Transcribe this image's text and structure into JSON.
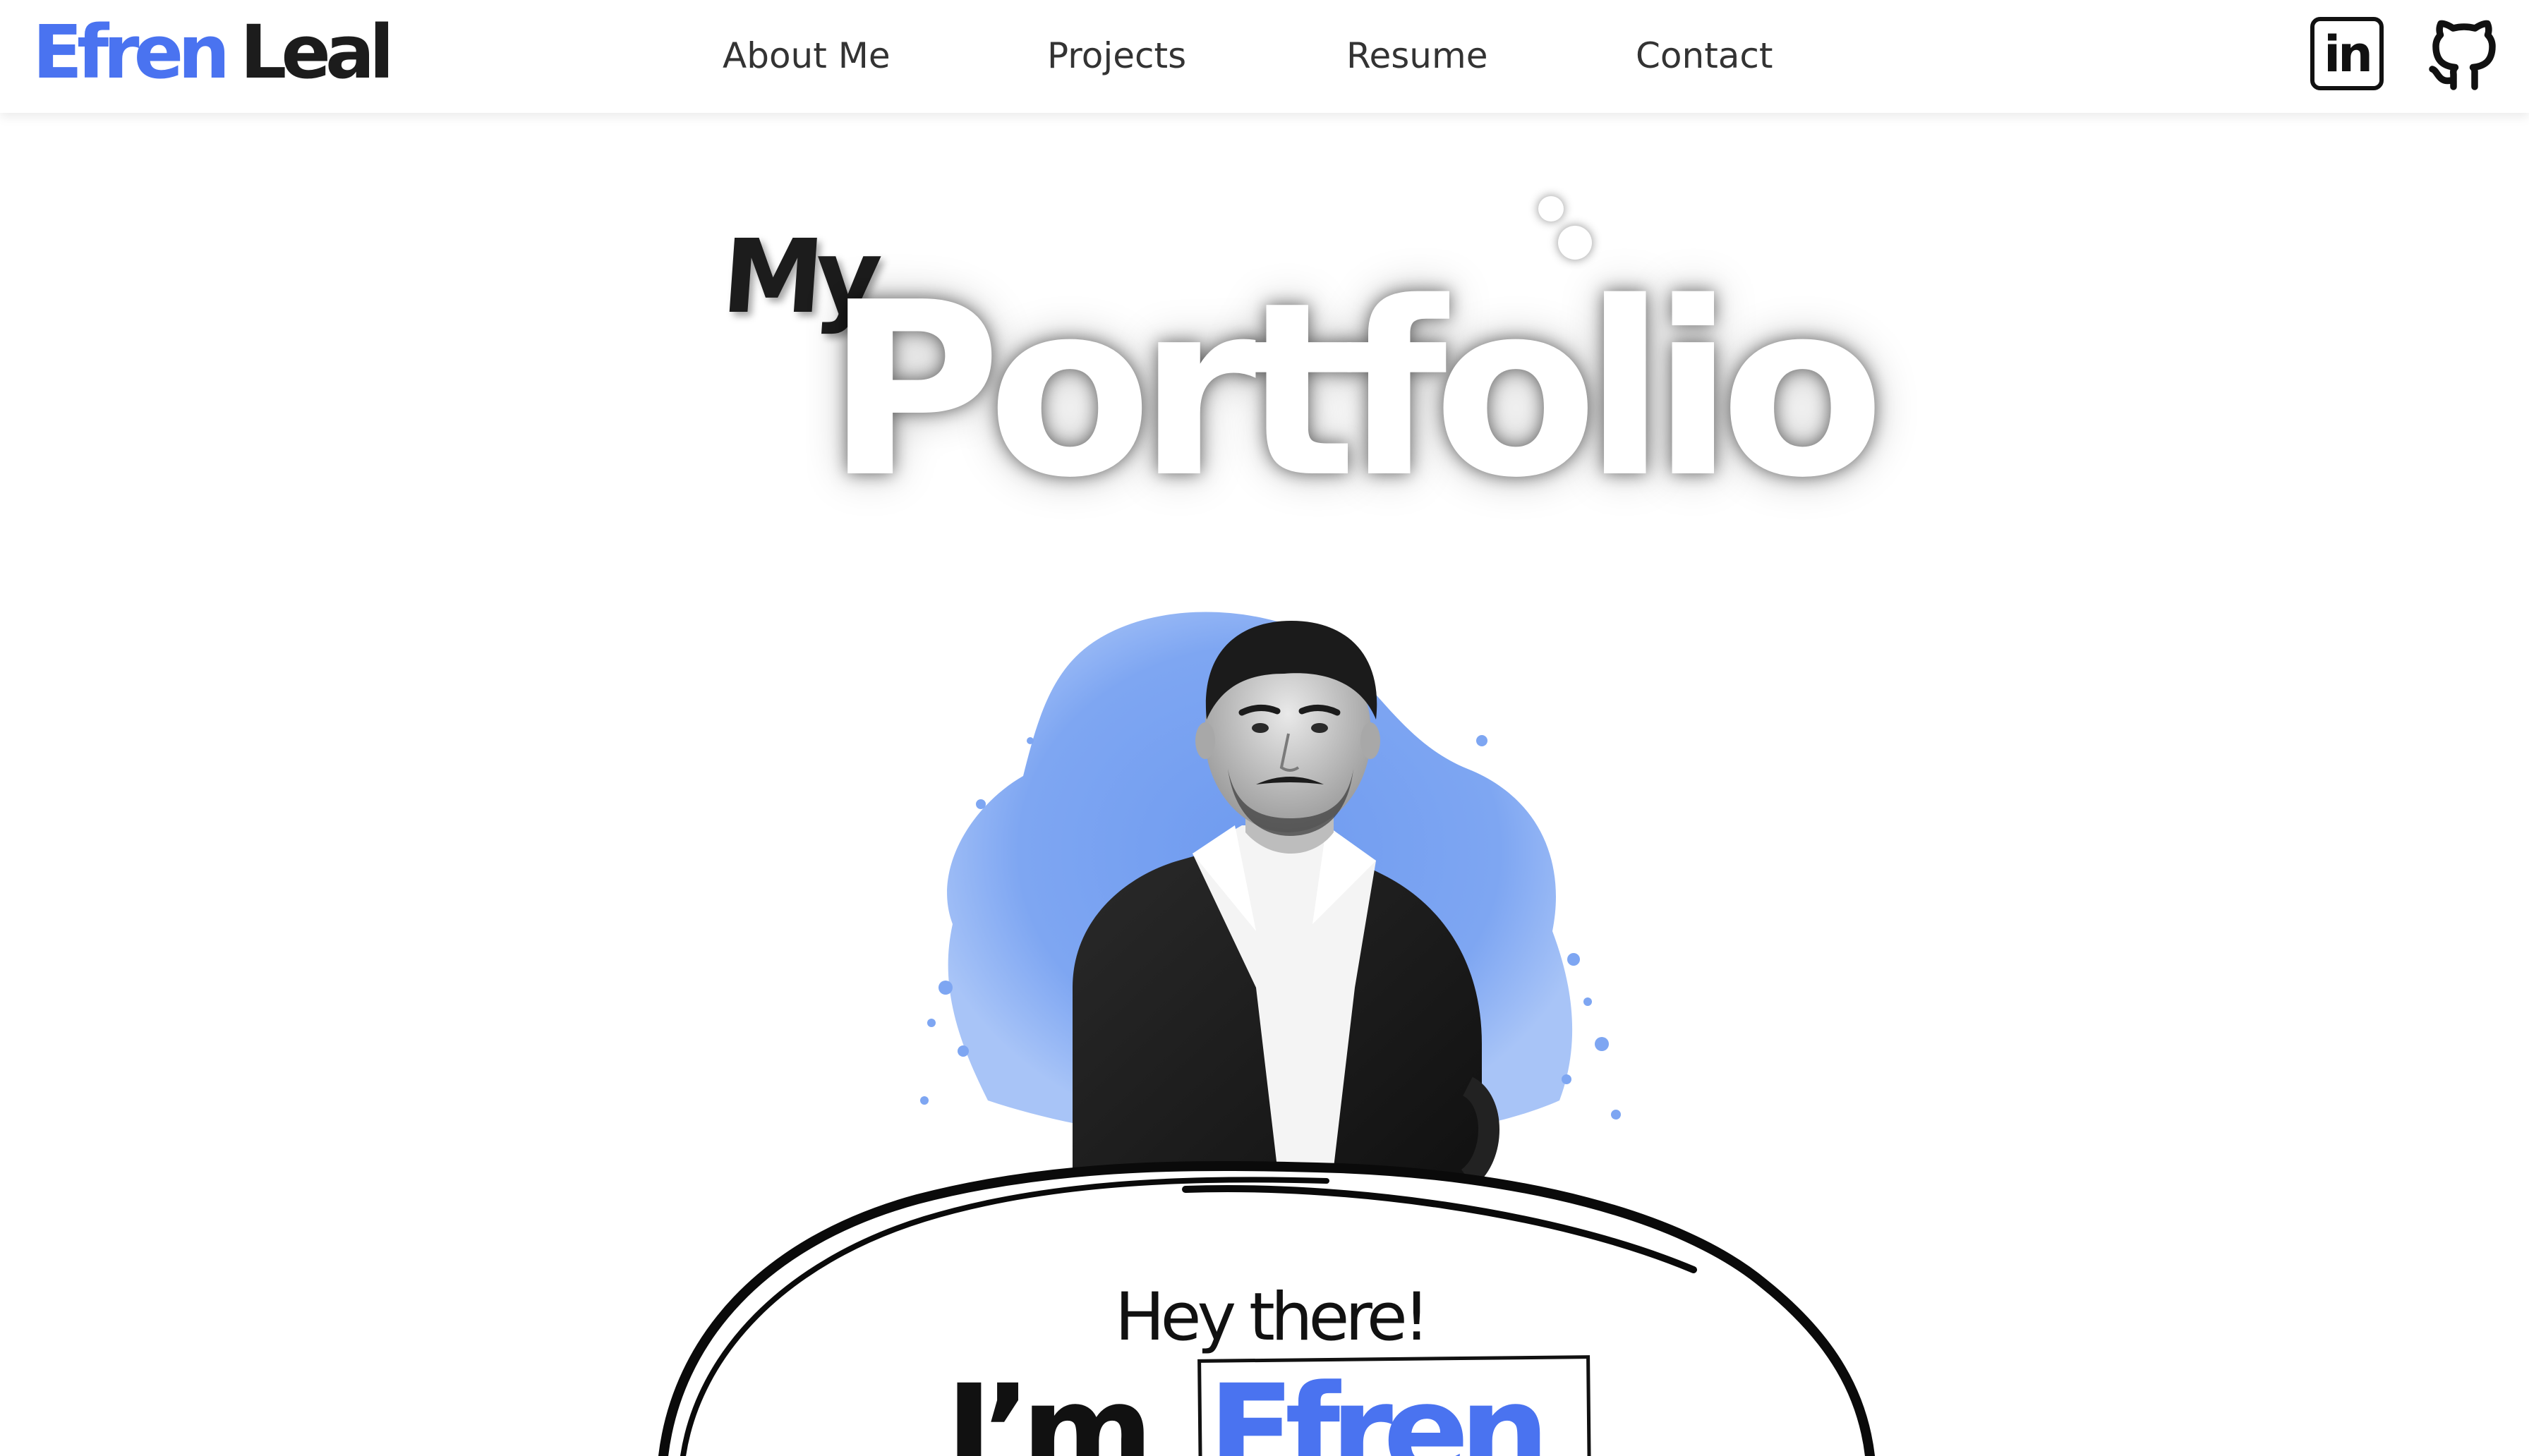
{
  "brand": {
    "first_name": "Efren",
    "last_name": "Leal"
  },
  "nav": {
    "items": [
      {
        "label": "About Me"
      },
      {
        "label": "Projects"
      },
      {
        "label": "Resume"
      },
      {
        "label": "Contact"
      }
    ]
  },
  "social": {
    "linkedin_label": "in",
    "linkedin_icon": "linkedin-icon",
    "github_icon": "github-icon"
  },
  "hero": {
    "title_small": "My",
    "title_large": "Portfolio",
    "greeting": "Hey there!",
    "intro": "I’m",
    "name": "Efren"
  },
  "colors": {
    "accent": "#4a73f0",
    "text_dark": "#1c1c1c",
    "splash_blue": "#6f9bf0"
  }
}
